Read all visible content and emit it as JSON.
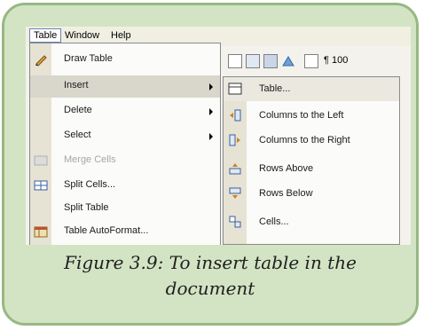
{
  "menubar": {
    "table": "Table",
    "window": "Window",
    "help": "Help"
  },
  "toolbar": {
    "zoom_text": "¶  100"
  },
  "dropdown": {
    "items": [
      {
        "label": "Draw Table",
        "icon": "pencil-icon",
        "has_submenu": false,
        "enabled": true
      },
      {
        "label": "Insert",
        "icon": "",
        "has_submenu": true,
        "enabled": true,
        "highlighted": true
      },
      {
        "label": "Delete",
        "icon": "",
        "has_submenu": true,
        "enabled": true
      },
      {
        "label": "Select",
        "icon": "",
        "has_submenu": true,
        "enabled": true
      },
      {
        "label": "Merge Cells",
        "icon": "merge-cells-icon",
        "has_submenu": false,
        "enabled": false
      },
      {
        "label": "Split Cells...",
        "icon": "split-cells-icon",
        "has_submenu": false,
        "enabled": true
      },
      {
        "label": "Split Table",
        "icon": "",
        "has_submenu": false,
        "enabled": true
      },
      {
        "label": "Table AutoFormat...",
        "icon": "table-autoformat-icon",
        "has_submenu": false,
        "enabled": true
      }
    ]
  },
  "submenu": {
    "items": [
      {
        "label": "Table...",
        "icon": "table-icon"
      },
      {
        "label": "Columns to the Left",
        "icon": "columns-left-icon"
      },
      {
        "label": "Columns to the Right",
        "icon": "columns-right-icon"
      },
      {
        "label": "Rows Above",
        "icon": "rows-above-icon"
      },
      {
        "label": "Rows Below",
        "icon": "rows-below-icon"
      },
      {
        "label": "Cells...",
        "icon": "cells-icon"
      }
    ]
  },
  "caption": {
    "line1": "Figure 3.9: To insert table in the",
    "line2": "document"
  },
  "colors": {
    "frame_bg": "#d3e4c4",
    "frame_border": "#97b882",
    "menu_bg": "#fbfbf9",
    "highlight": "#d9d7cc"
  }
}
